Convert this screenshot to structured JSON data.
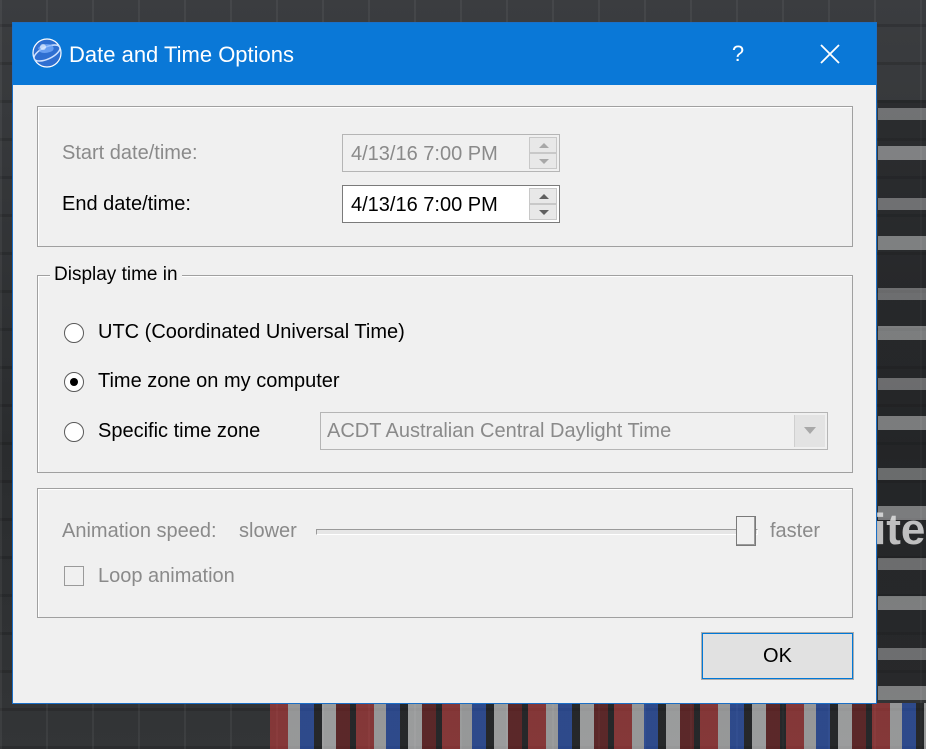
{
  "dialog": {
    "title": "Date and Time Options",
    "help_label": "?",
    "title_icon": "google-earth-globe-icon",
    "accent_color": "#0a78d7"
  },
  "dates": {
    "start_label": "Start date/time:",
    "start_value": "4/13/16 7:00 PM",
    "end_label": "End date/time:",
    "end_value": "4/13/16 7:00 PM"
  },
  "display_time": {
    "legend": "Display time in",
    "options": [
      {
        "label": "UTC (Coordinated Universal Time)",
        "checked": false
      },
      {
        "label": "Time zone on my computer",
        "checked": true
      },
      {
        "label": "Specific time zone",
        "checked": false
      }
    ],
    "timezone_value": "ACDT Australian Central Daylight Time"
  },
  "animation": {
    "speed_label": "Animation speed:",
    "slower_label": "slower",
    "faster_label": "faster",
    "speed_level": 1.0,
    "loop_label": "Loop animation",
    "loop_checked": false
  },
  "buttons": {
    "ok_label": "OK"
  },
  "background": {
    "text": "ite"
  }
}
